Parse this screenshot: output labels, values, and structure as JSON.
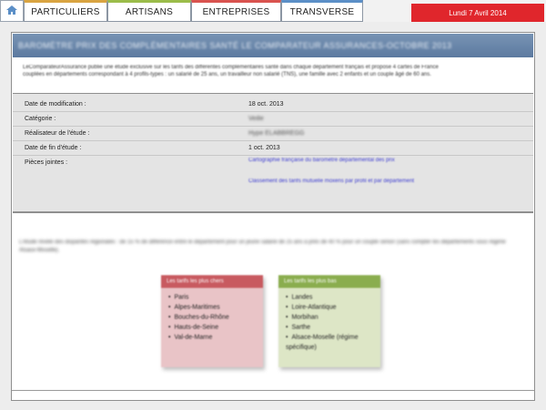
{
  "nav": {
    "home_icon": "home-icon",
    "tabs": [
      {
        "label": "PARTICULIERS",
        "accent": "#d9a441"
      },
      {
        "label": "ARTISANS",
        "accent": "#9bbc4a"
      },
      {
        "label": "ENTREPRISES",
        "accent": "#d9534f"
      },
      {
        "label": "TRANSVERSE",
        "accent": "#5b8fc7"
      }
    ],
    "date": "Lundi 7 Avril 2014"
  },
  "colors": {
    "date_badge": "#e0262c",
    "title_bar": "#5c7aa0",
    "details_bg": "#e4e4e4"
  },
  "article": {
    "title": "BAROMÈTRE PRIX DES COMPLÉMENTAIRES SANTÉ LE COMPARATEUR ASSURANCES-OCTOBRE 2013",
    "intro": "LeComparateurAssurance publie une étude exclusive sur les tarifs des différentes complémentaires santé dans chaque département français et propose 4 cartes de France couplées en départements correspondant à 4 profils-types : un salarié de 25 ans, un travailleur non salarié (TNS), une famille avec 2 enfants et un couple âgé de 60 ans."
  },
  "details": {
    "modified_label": "Date de modification :",
    "modified_value": "18 oct. 2013",
    "category_label": "Catégorie :",
    "category_value": "Veille",
    "author_label": "Réalisateur de l'étude :",
    "author_value": "Hype ELABBREGG",
    "end_label": "Date de fin d'étude :",
    "end_value": "1 oct. 2013",
    "attachments_label": "Pièces jointes :",
    "attachments": [
      "Cartographie française du baromètre départemental des prix",
      "Classement des tarifs mutuelle moxens par profil et par département"
    ]
  },
  "body": {
    "text": "L'étude révèle des disparités régionales : de 15 % de différence entre le département pour un jeune salarié de 25 ans à près de 40 % pour un couple senior (sans compter les départements sous régime Alsace-Moselle)."
  },
  "cards": {
    "expensive": {
      "title": "Les tarifs les plus chers",
      "items": [
        "Paris",
        "Alpes-Maritimes",
        "Bouches-du-Rhône",
        "Hauts-de-Seine",
        "Val-de-Marne"
      ]
    },
    "cheap": {
      "title": "Les tarifs les plus bas",
      "items": [
        "Landes",
        "Loire-Atlantique",
        "Morbihan",
        "Sarthe",
        "Alsace-Moselle (régime spécifique)"
      ]
    }
  }
}
